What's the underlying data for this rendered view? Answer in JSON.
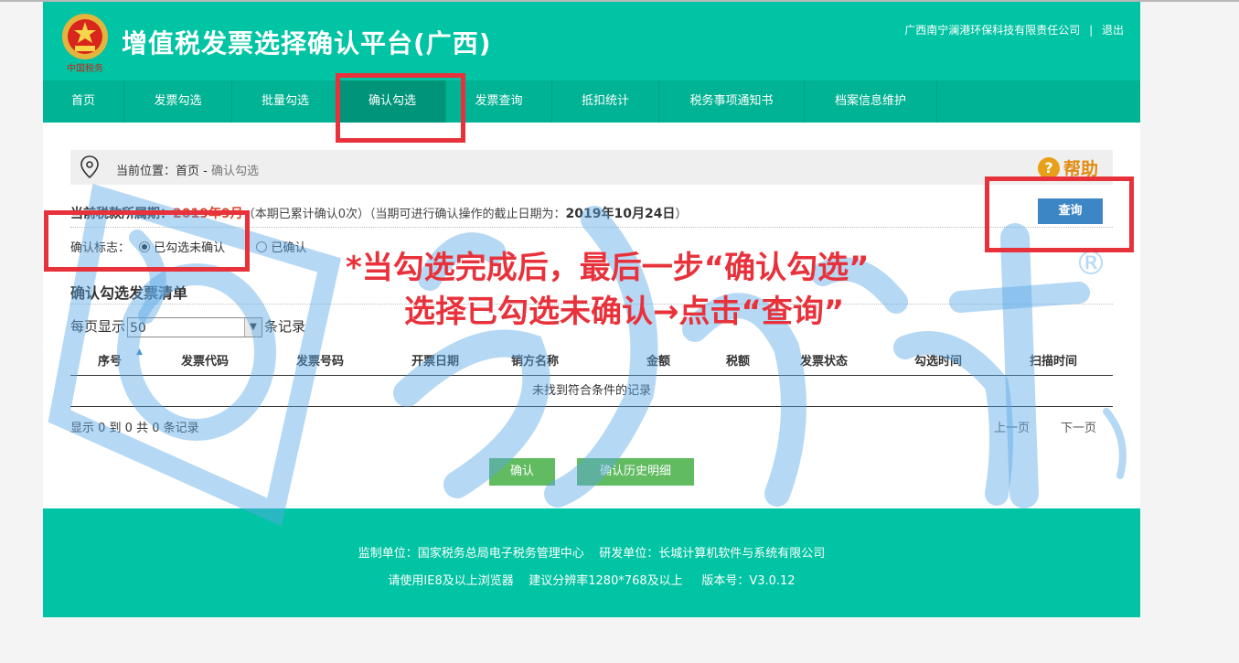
{
  "header": {
    "title": "增值税发票选择确认平台(广西)",
    "emblem_text": "中国税务",
    "company": "广西南宁澜港环保科技有限责任公司",
    "separator": "|",
    "logout": "退出"
  },
  "nav": {
    "items": [
      {
        "label": "首页"
      },
      {
        "label": "发票勾选"
      },
      {
        "label": "批量勾选"
      },
      {
        "label": "确认勾选"
      },
      {
        "label": "发票查询"
      },
      {
        "label": "抵扣统计"
      },
      {
        "label": "税务事项通知书"
      },
      {
        "label": "档案信息维护"
      }
    ],
    "active_index": 3
  },
  "breadcrumb": {
    "prefix": "当前位置：首页 - ",
    "current": "确认勾选"
  },
  "help": {
    "label": "帮助",
    "icon": "question-icon"
  },
  "period": {
    "label": "当前税款所属期：",
    "value": "2019年9月",
    "note": "（本期已累计确认0次）（当期可进行确认操作的截止日期为：",
    "deadline": "2019年10月24日",
    "close": "）"
  },
  "query_button": "查询",
  "flag": {
    "label": "确认标志：",
    "options": [
      "已勾选未确认",
      "已确认"
    ],
    "selected_index": 0
  },
  "list": {
    "title": "确认勾选发票清单",
    "page_size_prefix": "每页显示",
    "page_size": "50",
    "page_size_suffix": "条记录",
    "columns": [
      "序号",
      "发票代码",
      "发票号码",
      "开票日期",
      "销方名称",
      "金额",
      "税额",
      "发票状态",
      "勾选时间",
      "扫描时间"
    ],
    "empty_message": "未找到符合条件的记录",
    "info": "显示 0 到 0 共 0 条记录",
    "prev": "上一页",
    "next": "下一页"
  },
  "actions": {
    "confirm": "确认",
    "history": "确认历史明细"
  },
  "footer": {
    "line1": "监制单位：国家税务总局电子税务管理中心    研发单位：长城计算机软件与系统有限公司",
    "line2": "请使用IE8及以上浏览器    建议分辨率1280*768及以上     版本号：V3.0.12"
  },
  "annotation": {
    "line1": "*当勾选完成后，最后一步“确认勾选”",
    "line2": "选择已勾选未确认→点击“查询”"
  },
  "watermark": {
    "registered": "®"
  },
  "colors": {
    "brand": "#00c4a3",
    "nav": "#00b394",
    "nav_active": "#00957b",
    "query_button": "#3d86c6",
    "green_button": "#61bb61",
    "highlight_red": "#e8323b",
    "period_red": "#d9442c"
  }
}
